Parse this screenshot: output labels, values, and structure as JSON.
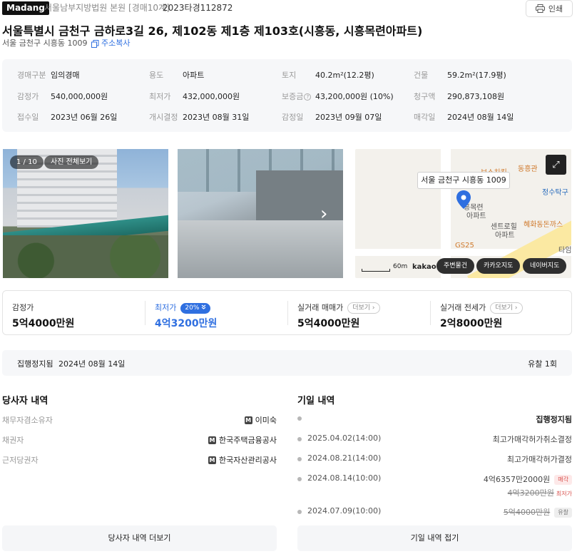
{
  "header": {
    "logo": "Madang",
    "court": "서울남부지방법원 본원 [경매10계]",
    "case_no": "2023타경112872",
    "print_label": "인쇄"
  },
  "property": {
    "title": "서울특별시 금천구 금하로3길 26, 제102동 제1층 제103호(시흥동, 시흥목련아파트)",
    "sub_address": "서울 금천구 시흥동 1009",
    "copy_address_label": "주소복사"
  },
  "info": [
    {
      "k": "경매구분",
      "v": "임의경매"
    },
    {
      "k": "용도",
      "v": "아파트"
    },
    {
      "k": "토지",
      "v": "40.2m²(12.2평)"
    },
    {
      "k": "건물",
      "v": "59.2m²(17.9평)"
    },
    {
      "k": "감정가",
      "v": "540,000,000원"
    },
    {
      "k": "최저가",
      "v": "432,000,000원"
    },
    {
      "k": "보증금",
      "v": "43,200,000원 (10%)"
    },
    {
      "k": "청구액",
      "v": "290,873,108원"
    },
    {
      "k": "접수일",
      "v": "2023년 06월 26일"
    },
    {
      "k": "개시결정",
      "v": "2023년 08월 31일"
    },
    {
      "k": "감정일",
      "v": "2023년 09월 07일"
    },
    {
      "k": "매각일",
      "v": "2024년 08월 14일"
    }
  ],
  "photos": {
    "counter": "1 / 10",
    "view_all": "사진 전체보기"
  },
  "map": {
    "callout": "서울 금천구 시흥동 1009",
    "scale": "60m",
    "brand": "kakao",
    "labels": [
      "동흥관",
      "보스치킨",
      "정수탁구",
      "흥목련",
      "아파트",
      "센트로힐",
      "아파트",
      "혜화동돈까스",
      "GS25",
      "타임"
    ],
    "buttons": [
      "주변물건",
      "카카오지도",
      "네이버지도"
    ]
  },
  "prices": [
    {
      "label": "감정가",
      "value": "5억4000만원"
    },
    {
      "label": "최저가",
      "value": "4억3200만원",
      "badge": "20%"
    },
    {
      "label": "실거래 매매가",
      "value": "5억4000만원",
      "more": "더보기"
    },
    {
      "label": "실거래 전세가",
      "value": "2억8000만원",
      "more": "더보기"
    }
  ],
  "status": {
    "label": "집행정지됨",
    "date": "2024년 08월 14일",
    "fail_count": "유찰 1회"
  },
  "parties": {
    "title": "당사자 내역",
    "rows": [
      {
        "role": "채무자겸소유자",
        "name": "이미숙"
      },
      {
        "role": "채권자",
        "name": "한국주택금융공사"
      },
      {
        "role": "근저당권자",
        "name": "한국자산관리공사"
      }
    ],
    "more_button": "당사자 내역 더보기"
  },
  "history": {
    "title": "기일 내역",
    "rows": [
      {
        "date": "",
        "event": "집행정지됨"
      },
      {
        "date": "2025.04.02(14:00)",
        "event": "최고가매각허가취소결정"
      },
      {
        "date": "2024.08.21(14:00)",
        "event": "최고가매각허가결정"
      },
      {
        "date": "2024.08.14(10:00)",
        "event": "4억6357만2000원",
        "tag": "매각",
        "sub": "4억3200만원",
        "sub_note": "최저가"
      },
      {
        "date": "2024.07.09(10:00)",
        "event": "5억4000만원",
        "tag": "유찰"
      }
    ],
    "fold_button": "기일 내역 접기"
  },
  "colors": {
    "accent": "#2f6fe0",
    "danger": "#d9534f"
  }
}
